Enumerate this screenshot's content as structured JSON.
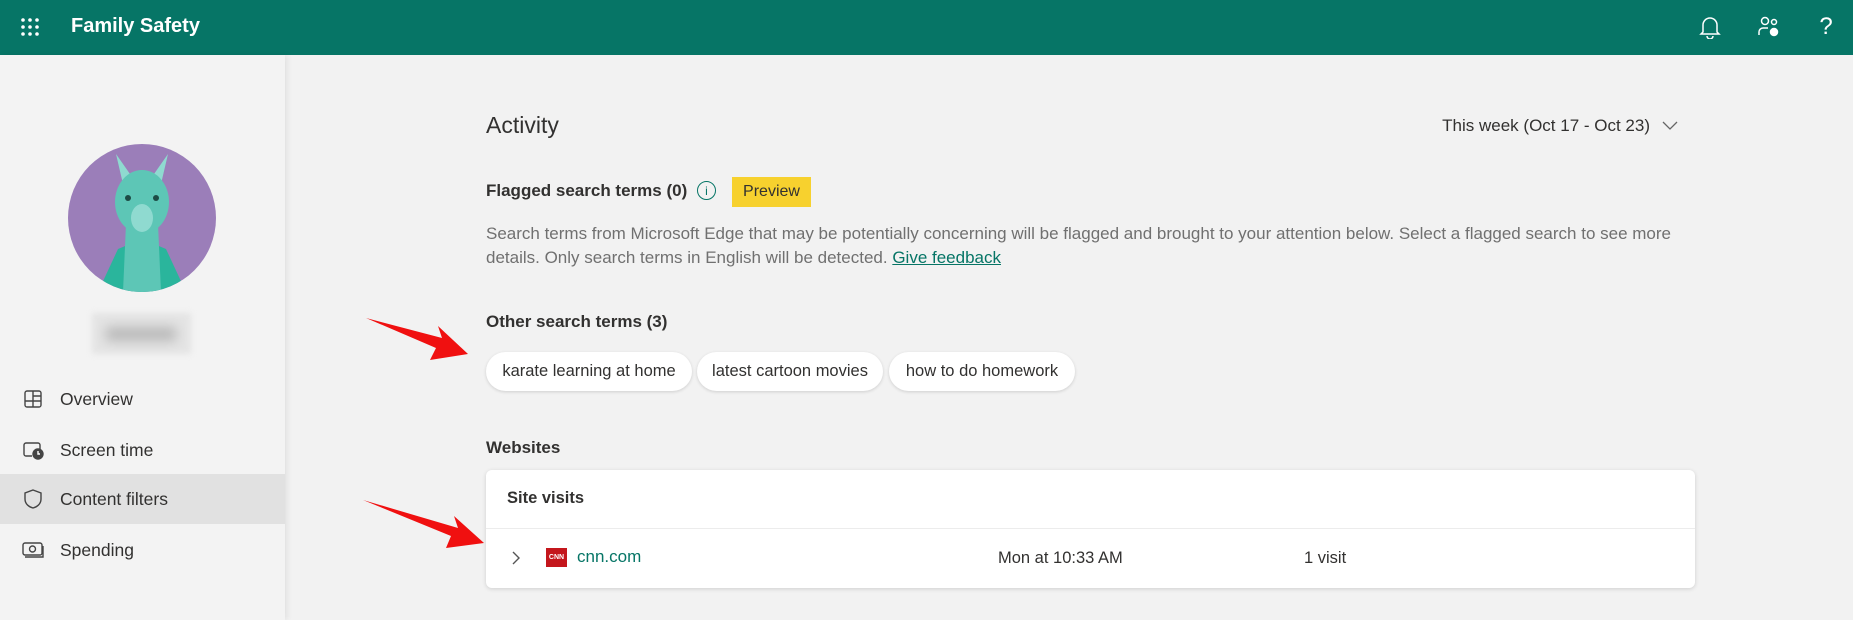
{
  "header": {
    "title": "Family Safety",
    "icons": [
      "app-launcher-icon",
      "bell-icon",
      "family-settings-icon",
      "help-icon"
    ],
    "background": "#067566"
  },
  "sidebar": {
    "items": [
      {
        "label": "Overview",
        "icon": "overview-icon",
        "selected": false
      },
      {
        "label": "Screen time",
        "icon": "screen-time-icon",
        "selected": false
      },
      {
        "label": "Content filters",
        "icon": "shield-icon",
        "selected": true
      },
      {
        "label": "Spending",
        "icon": "money-icon",
        "selected": false
      }
    ]
  },
  "main": {
    "title": "Activity",
    "date_range": "This week (Oct 17 - Oct 23)",
    "flagged": {
      "title": "Flagged search terms (0)",
      "badge": "Preview",
      "description": "Search terms from Microsoft Edge that may be potentially concerning will be flagged and brought to your attention below. Select a flagged search to see more details. Only search terms in English will be detected.",
      "feedback_link": "Give feedback"
    },
    "other": {
      "title": "Other search terms (3)",
      "terms": [
        "karate learning at home",
        "latest cartoon movies",
        "how to do homework"
      ]
    },
    "websites": {
      "title": "Websites",
      "card_title": "Site visits",
      "rows": [
        {
          "site": "cnn.com",
          "logo": "CNN",
          "time": "Mon at 10:33 AM",
          "visits": "1 visit"
        }
      ]
    }
  }
}
